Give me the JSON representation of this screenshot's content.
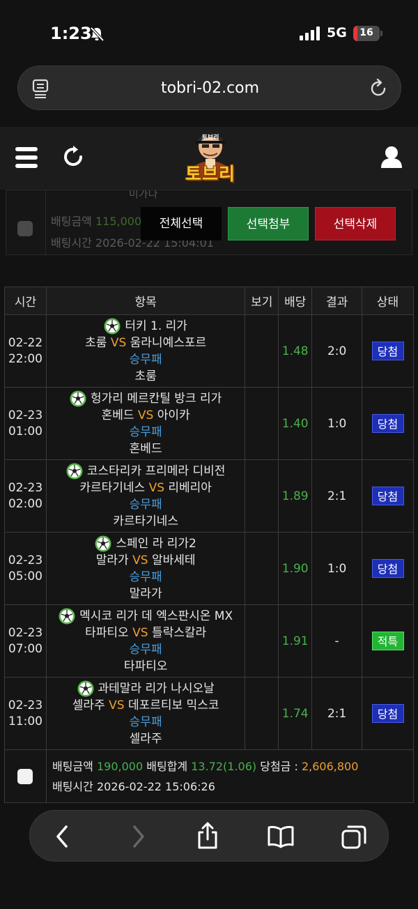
{
  "status_bar": {
    "time": "1:23",
    "network": "5G",
    "battery": "16",
    "battery_level_percent": 16,
    "icons": [
      "bell-slash-icon",
      "signal-icon",
      "battery-icon"
    ]
  },
  "browser": {
    "url": "tobri-02.com",
    "icons": [
      "reader-icon",
      "reload-icon"
    ]
  },
  "site_header": {
    "logo_text": "토브리",
    "logo_small_text": "토브리",
    "icons": [
      "menu-icon",
      "refresh-icon",
      "user-icon"
    ]
  },
  "prev_summary": {
    "fragment_text": "미가다",
    "amount_label": "배팅금액",
    "amount_value": "115,000",
    "time_label": "배팅시간",
    "time_value": "2026-02-22 15:04:01"
  },
  "actions": {
    "select_all": "전체선택",
    "attach": "선택첨부",
    "delete": "선택삭제"
  },
  "table": {
    "headers": {
      "time": "시간",
      "item": "항목",
      "view": "보기",
      "odds": "배당",
      "result": "결과",
      "status": "상태"
    },
    "rows": [
      {
        "date": "02-22",
        "hour": "22:00",
        "league": "터키 1. 리가",
        "home": "초룸",
        "vs": "VS",
        "away": "움라니예스포르",
        "market": "승무패",
        "pick": "초룸",
        "view": "",
        "odds": "1.48",
        "result": "2:0",
        "status": "당첨",
        "status_type": "win"
      },
      {
        "date": "02-23",
        "hour": "01:00",
        "league": "헝가리 메르칸틸 방크 리가",
        "home": "혼베드",
        "vs": "VS",
        "away": "아이카",
        "market": "승무패",
        "pick": "혼베드",
        "view": "",
        "odds": "1.40",
        "result": "1:0",
        "status": "당첨",
        "status_type": "win"
      },
      {
        "date": "02-23",
        "hour": "02:00",
        "league": "코스타리카 프리메라 디비전",
        "home": "카르타기네스",
        "vs": "VS",
        "away": "리베리아",
        "market": "승무패",
        "pick": "카르타기네스",
        "view": "",
        "odds": "1.89",
        "result": "2:1",
        "status": "당첨",
        "status_type": "win"
      },
      {
        "date": "02-23",
        "hour": "05:00",
        "league": "스페인 라 리가2",
        "home": "말라가",
        "vs": "VS",
        "away": "알바세테",
        "market": "승무패",
        "pick": "말라가",
        "view": "",
        "odds": "1.90",
        "result": "1:0",
        "status": "당첨",
        "status_type": "win"
      },
      {
        "date": "02-23",
        "hour": "07:00",
        "league": "멕시코 리가 데 엑스판시온 MX",
        "home": "타파티오",
        "vs": "VS",
        "away": "틀락스칼라",
        "market": "승무패",
        "pick": "타파티오",
        "view": "",
        "odds": "1.91",
        "result": "-",
        "status": "적특",
        "status_type": "special"
      },
      {
        "date": "02-23",
        "hour": "11:00",
        "league": "과테말라 리가 나시오날",
        "home": "셀라주",
        "vs": "VS",
        "away": "데포르티보 믹스코",
        "market": "승무패",
        "pick": "셀라주",
        "view": "",
        "odds": "1.74",
        "result": "2:1",
        "status": "당첨",
        "status_type": "win"
      }
    ]
  },
  "summary": {
    "amount_label": "배팅금액",
    "amount_value": "190,000",
    "total_label": "배팅합계",
    "total_value": "13.72(1.06)",
    "payout_label": "당첨금 :",
    "payout_value": "2,606,800",
    "time_label": "배팅시간",
    "time_value": "2026-02-22 15:06:26"
  },
  "toolbar": {
    "icons": [
      "back-icon",
      "forward-icon",
      "share-icon",
      "bookmarks-icon",
      "tabs-icon"
    ]
  },
  "colors": {
    "odds": "#46b24a",
    "vs": "#f0a030",
    "market": "#4a9fe0",
    "win_badge": "#1e2fb8",
    "special_badge": "#22b533",
    "attach_button": "#1d7a35",
    "delete_button": "#a3101c"
  }
}
